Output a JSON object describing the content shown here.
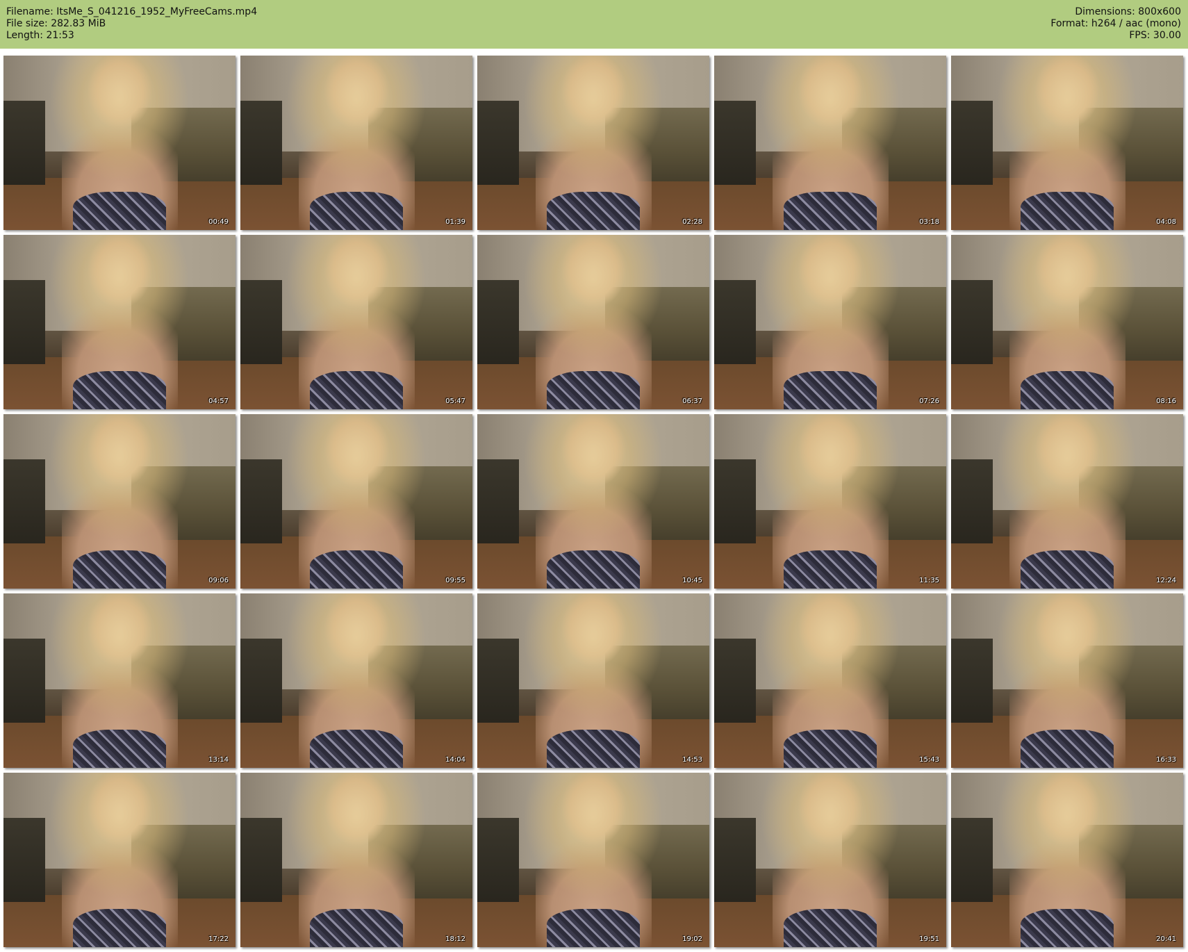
{
  "header": {
    "filename": "Filename: ItsMe_S_041216_1952_MyFreeCams.mp4",
    "filesize": "File size: 282.83 MiB",
    "length": "Length: 21:53",
    "dimensions": "Dimensions: 800x600",
    "format": "Format: h264 / aac (mono)",
    "fps": "FPS: 30.00"
  },
  "thumbnails": [
    {
      "time": "00:49"
    },
    {
      "time": "01:39"
    },
    {
      "time": "02:28"
    },
    {
      "time": "03:18"
    },
    {
      "time": "04:08"
    },
    {
      "time": "04:57"
    },
    {
      "time": "05:47"
    },
    {
      "time": "06:37"
    },
    {
      "time": "07:26"
    },
    {
      "time": "08:16"
    },
    {
      "time": "09:06"
    },
    {
      "time": "09:55"
    },
    {
      "time": "10:45"
    },
    {
      "time": "11:35"
    },
    {
      "time": "12:24"
    },
    {
      "time": "13:14"
    },
    {
      "time": "14:04"
    },
    {
      "time": "14:53"
    },
    {
      "time": "15:43"
    },
    {
      "time": "16:33"
    },
    {
      "time": "17:22"
    },
    {
      "time": "18:12"
    },
    {
      "time": "19:02"
    },
    {
      "time": "19:51"
    },
    {
      "time": "20:41"
    }
  ],
  "colors": {
    "header_bg": "#b1cc80",
    "timestamp_text": "#ffffff"
  }
}
